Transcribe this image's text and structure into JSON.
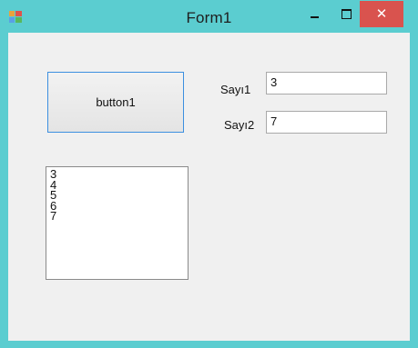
{
  "window": {
    "title": "Form1",
    "controls": {
      "minimize_icon": "minimize-icon",
      "maximize_icon": "maximize-icon",
      "close_icon": "close-icon",
      "close_color": "#d9534e",
      "frame_color": "#5bcdd0"
    }
  },
  "form": {
    "button1_label": "button1",
    "sayi1_label": "Sayı1",
    "sayi1_value": "3",
    "sayi2_label": "Sayı2",
    "sayi2_value": "7",
    "list_items": [
      "3",
      "4",
      "5",
      "6",
      "7"
    ]
  }
}
